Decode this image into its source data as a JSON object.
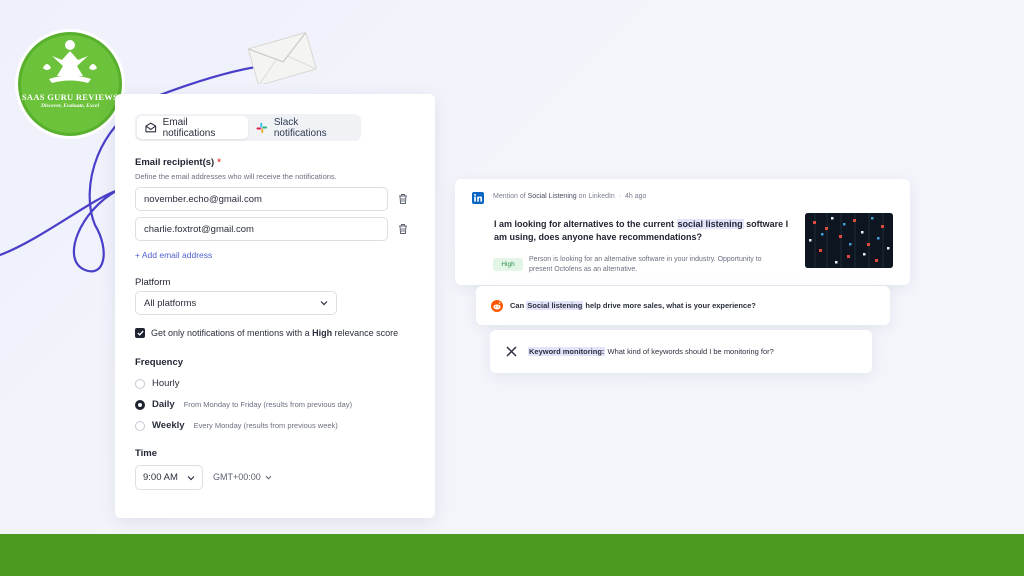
{
  "logo": {
    "title": "SAAS GURU REVIEWS",
    "tagline": "Discover, Evaluate, Excel"
  },
  "tabs": [
    {
      "label": "Email notifications",
      "icon": "envelope-icon",
      "active": true
    },
    {
      "label": "Slack notifications",
      "icon": "slack-icon",
      "active": false
    }
  ],
  "email": {
    "label": "Email recipient(s)",
    "required_mark": "*",
    "hint": "Define the email addresses who will receive the notifications.",
    "recipients": [
      "november.echo@gmail.com",
      "charlie.foxtrot@gmail.com"
    ],
    "add_label": "+ Add email address"
  },
  "platform": {
    "label": "Platform",
    "selected": "All platforms"
  },
  "relevance": {
    "text_before": "Get only notifications of mentions with a ",
    "bold": "High",
    "text_after": " relevance score",
    "checked": true
  },
  "frequency": {
    "label": "Frequency",
    "options": [
      {
        "label": "Hourly",
        "sub": "",
        "selected": false
      },
      {
        "label": "Daily",
        "sub": "From Monday to Friday (results from previous day)",
        "selected": true
      },
      {
        "label": "Weekly",
        "sub": "Every Monday (results from previous week)",
        "selected": false
      }
    ]
  },
  "time": {
    "label": "Time",
    "selected": "9:00 AM",
    "timezone": "GMT+00:00"
  },
  "mentions": [
    {
      "platform_icon": "linkedin-icon",
      "head_prefix": "Mention of ",
      "head_keyword": "Social Listening",
      "head_suffix": " on LinkedIn",
      "time": "4h ago",
      "title_before": "I am looking for alternatives to the current ",
      "title_keyword": "social listening",
      "title_after": " software I am using, does anyone have recommendations?",
      "badge": "High",
      "description": "Person is looking for an alternative software in your industry. Opportunity to present Octolens as an alternative."
    },
    {
      "platform_icon": "reddit-icon",
      "text_before": "Can ",
      "keyword": "Social listening",
      "text_after": " help drive more sales, what is your experience?"
    },
    {
      "platform_icon": "x-icon",
      "keyword": "Keyword monitoring:",
      "text_after": " What kind of keywords should I be monitoring for?"
    }
  ],
  "colors": {
    "accent": "#4f5fd0",
    "footer": "#4c9a1f",
    "curve": "#4a3fc9",
    "badge_bg": "#e2f5e7"
  }
}
